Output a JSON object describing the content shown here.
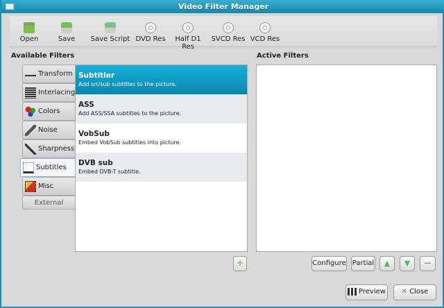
{
  "window": {
    "title": "Video Filter Manager"
  },
  "toolbar": [
    {
      "label": "Open",
      "icon": "folder-open-icon"
    },
    {
      "label": "Save",
      "icon": "save-icon"
    },
    {
      "label": "Save Script",
      "icon": "save-script-icon"
    },
    {
      "label": "DVD Res",
      "icon": "disc-icon"
    },
    {
      "label": "Half D1 Res",
      "icon": "disc-icon"
    },
    {
      "label": "SVCD Res",
      "icon": "disc-icon"
    },
    {
      "label": "VCD Res",
      "icon": "disc-icon"
    }
  ],
  "available": {
    "title": "Available Filters",
    "categories": [
      {
        "label": "Transform",
        "icon": "transform-icon"
      },
      {
        "label": "Interlacing",
        "icon": "interlacing-icon"
      },
      {
        "label": "Colors",
        "icon": "colors-icon"
      },
      {
        "label": "Noise",
        "icon": "noise-icon"
      },
      {
        "label": "Sharpness",
        "icon": "sharpness-icon"
      },
      {
        "label": "Subtitles",
        "icon": "subtitles-icon",
        "selected": true
      },
      {
        "label": "Misc",
        "icon": "misc-icon"
      },
      {
        "label": "External"
      }
    ],
    "filters": [
      {
        "name": "Subtitler",
        "desc": "Add srt/sub subtitles to the picture.",
        "selected": true
      },
      {
        "name": "ASS",
        "desc": "Add ASS/SSA subtitles to the picture."
      },
      {
        "name": "VobSub",
        "desc": "Embed VobSub subtitles into picture."
      },
      {
        "name": "DVB sub",
        "desc": "Embed DVB-T subtitle."
      }
    ]
  },
  "active": {
    "title": "Active Filters"
  },
  "buttons": {
    "configure": "Configure",
    "partial": "Partial",
    "preview": "Preview",
    "close": "Close"
  },
  "colors": {
    "accent": "#0f9ac4",
    "title_bar": "#1e8db0"
  }
}
